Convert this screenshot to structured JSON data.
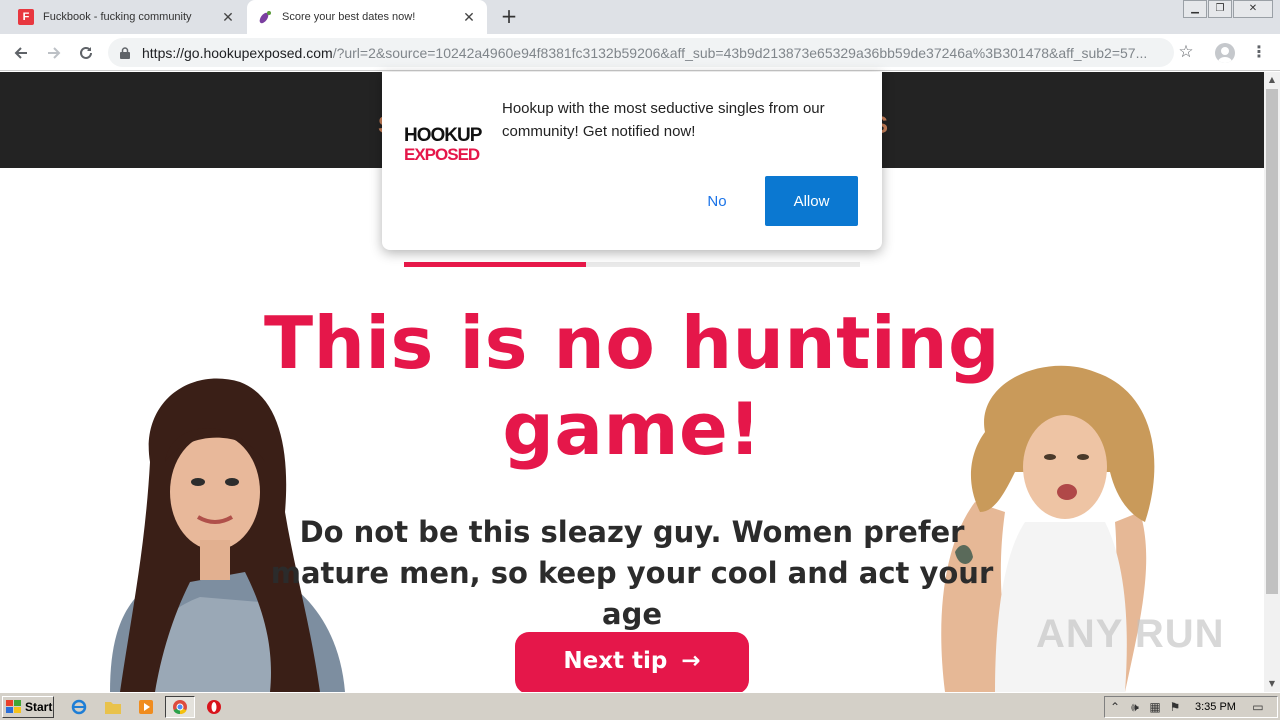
{
  "browser": {
    "tabs": [
      {
        "title": "Fuckbook - fucking community",
        "favicon": "F",
        "active": false
      },
      {
        "title": "Score your best dates now!",
        "favicon": "eggplant-icon",
        "active": true
      }
    ],
    "new_tab_label": "+",
    "url_host": "https://go.hookupexposed.com",
    "url_rest": "/?url=2&source=10242a4960e94f8381fc3132b59206&aff_sub=43b9d213873e65329a36bb59de37246a%3B301478&aff_sub2=57..."
  },
  "page": {
    "band_fragment_left": "S",
    "band_fragment_right": "S",
    "progress_fraction": 0.4,
    "headline": "This is no hunting game!",
    "subtext": "Do not be this sleazy guy. Women prefer mature men, so keep your cool and act your age",
    "next_button": "Next tip",
    "next_arrow": "→",
    "accent_color": "#e5174a"
  },
  "popup": {
    "logo_line1": "HOOKUP",
    "logo_line2": "EXPOSED",
    "message": "Hookup with the most seductive singles from our community! Get notified now!",
    "no_label": "No",
    "allow_label": "Allow"
  },
  "watermark": "ANY RUN",
  "taskbar": {
    "start_label": "Start",
    "clock": "3:35 PM"
  }
}
